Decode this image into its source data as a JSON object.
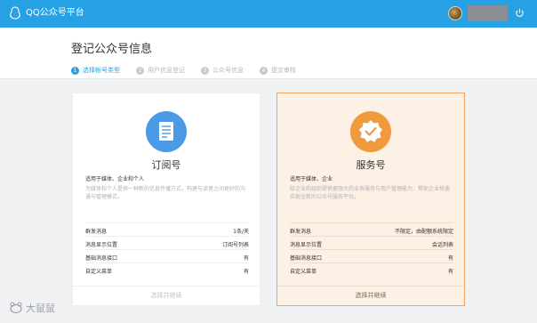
{
  "topbar": {
    "app_title": "QQ公众号平台",
    "logo_icon": "qq-penguin-icon",
    "power_icon": "power-icon",
    "bg_color": "#27a1e6"
  },
  "header": {
    "page_title": "登记公众号信息",
    "steps": [
      {
        "num": "1",
        "label": "选择帐号类型",
        "active": true
      },
      {
        "num": "2",
        "label": "用户信息登记",
        "active": false
      },
      {
        "num": "3",
        "label": "公众号信息",
        "active": false
      },
      {
        "num": "4",
        "label": "提交审核",
        "active": false
      }
    ]
  },
  "cards": [
    {
      "name": "订阅号",
      "icon": "document-icon",
      "audience": "适用于媒体、企业和个人",
      "description": "为媒体和个人提供一种新的信息传播方式，构建与读者之间更好的沟通与管理模式。",
      "features": [
        {
          "label": "群发消息",
          "value": "1条/天"
        },
        {
          "label": "消息显示位置",
          "value": "订阅号列表"
        },
        {
          "label": "基础消息接口",
          "value": "有"
        },
        {
          "label": "自定义菜单",
          "value": "有"
        }
      ],
      "button": "选择并继续"
    },
    {
      "name": "服务号",
      "icon": "badge-check-icon",
      "audience": "适用于媒体、企业",
      "description": "给企业和组织提供更强大的业务服务与用户管理能力，帮助企业快速实现全新的公众号服务平台。",
      "features": [
        {
          "label": "群发消息",
          "value": "不限定，由配额系统限定"
        },
        {
          "label": "消息显示位置",
          "value": "会话列表"
        },
        {
          "label": "基础消息接口",
          "value": "有"
        },
        {
          "label": "自定义菜单",
          "value": "有"
        }
      ],
      "button": "选择并继续"
    }
  ],
  "watermark": {
    "text": "大鼠鼠",
    "icon": "mouse-logo-icon"
  },
  "colors": {
    "accent_blue": "#27a1e6",
    "service_orange": "#f09a3e",
    "subscription_blue": "#4a9ae6"
  }
}
